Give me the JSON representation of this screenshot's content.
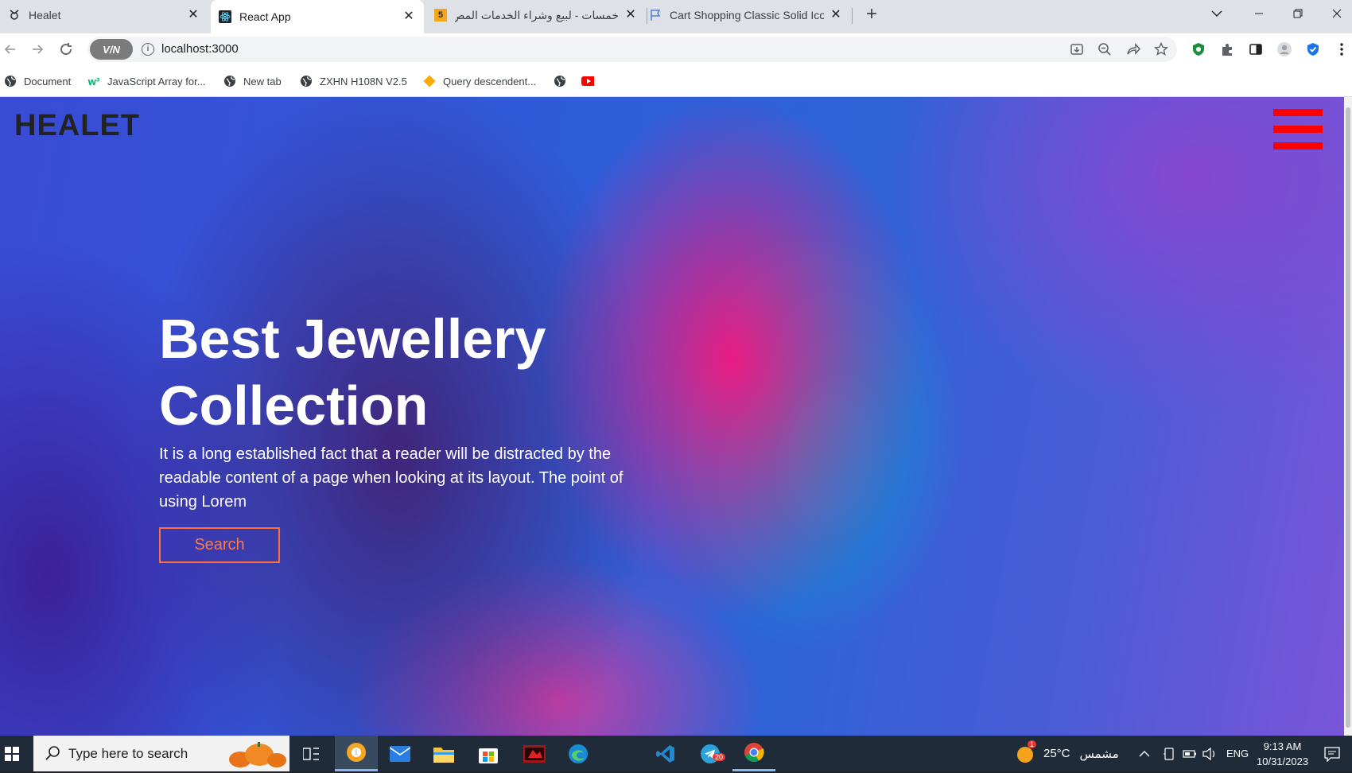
{
  "browser": {
    "tabs": [
      {
        "title": "Healet",
        "favicon": "healet-logo-icon",
        "active": false
      },
      {
        "title": "React App",
        "favicon": "react-icon",
        "active": true
      },
      {
        "title": "خمسات - لبيع وشراء الخدمات المص",
        "favicon": "khamsat-icon",
        "active": false
      },
      {
        "title": "Cart Shopping Classic Solid Icon",
        "favicon": "flag-icon",
        "active": false
      }
    ],
    "khamsat_badge": "5",
    "url": "localhost:3000",
    "vpn_label": "V/N",
    "bookmarks": [
      {
        "label": "Document",
        "icon": "globe-icon"
      },
      {
        "label": "JavaScript Array for...",
        "icon": "w3-icon"
      },
      {
        "label": "New tab",
        "icon": "globe-icon"
      },
      {
        "label": "ZXHN H108N V2.5",
        "icon": "globe-icon"
      },
      {
        "label": "Query descendent...",
        "icon": "diamond-icon"
      }
    ]
  },
  "page": {
    "logo": "HEALET",
    "hero": {
      "title_line1": "Best Jewellery",
      "title_line2": "Collection",
      "description": "It is a long established fact that a reader will be distracted by the readable content of a page when looking at its layout. The point of using Lorem",
      "button_label": "Search"
    },
    "colors": {
      "hamburger": "#ff0000",
      "button_border": "#ff6d3a",
      "logo": "#222222"
    }
  },
  "taskbar": {
    "search_placeholder": "Type here to search",
    "weather_temp": "25°C",
    "weather_text": "مشمس",
    "language": "ENG",
    "time": "9:13 AM",
    "date": "10/31/2023",
    "telegram_badge": "20",
    "weather_badge": "1"
  }
}
